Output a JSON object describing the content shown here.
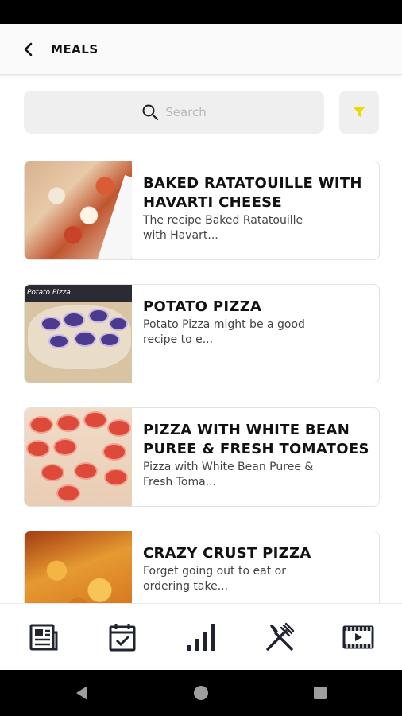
{
  "header": {
    "title": "MEALS",
    "back_icon": "chevron-left-icon"
  },
  "search": {
    "placeholder": "Search",
    "icon": "search-icon"
  },
  "filter": {
    "icon": "filter-icon",
    "icon_color": "#f2e300"
  },
  "meals": [
    {
      "title": "BAKED RATATOUILLE WITH HAVARTI CHEESE",
      "description": "The recipe Baked Ratatouille with Havart..."
    },
    {
      "title": "POTATO PIZZA",
      "description": "Potato Pizza might be a good recipe to e...",
      "thumb_caption": "Potato Pizza"
    },
    {
      "title": "PIZZA WITH WHITE BEAN PUREE & FRESH TOMATOES",
      "description": "Pizza with White Bean Puree & Fresh Toma..."
    },
    {
      "title": "CRAZY CRUST PIZZA",
      "description": "Forget going out to eat or ordering take..."
    }
  ],
  "bottom_nav": [
    {
      "icon": "newspaper-icon"
    },
    {
      "icon": "calendar-check-icon"
    },
    {
      "icon": "bar-chart-icon"
    },
    {
      "icon": "fork-knife-icon"
    },
    {
      "icon": "film-play-icon"
    }
  ],
  "system_nav": [
    "back-triangle-icon",
    "home-circle-icon",
    "recents-square-icon"
  ]
}
